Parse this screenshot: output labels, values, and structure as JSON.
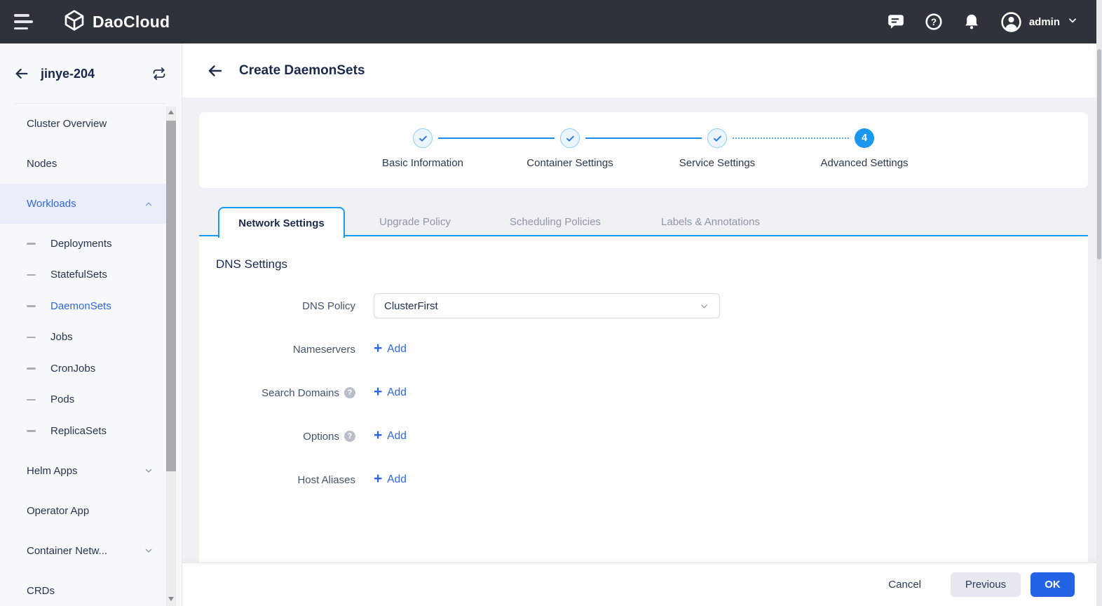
{
  "colors": {
    "topbar_bg": "#2e333b",
    "sidebar_bg": "#f7f8fa",
    "sidebar_active_bg": "#e9eef9",
    "main_bg": "#eff1f5",
    "accent": "#189af0",
    "link": "#3166e3",
    "ok_button": "#2563e6",
    "previous_button_bg": "#e7e9f0",
    "step_done_fill": "#eaf5fe",
    "step_done_border": "#8ecdf8",
    "muted_text": "#9097a5"
  },
  "topbar": {
    "brand": "DaoCloud",
    "user": "admin",
    "icons": [
      "menu-icon",
      "daocloud-logo-icon",
      "chat-icon",
      "help-icon",
      "bell-icon",
      "avatar-icon",
      "chevron-down-icon"
    ]
  },
  "sidebar": {
    "cluster": "jinye-204",
    "items": [
      {
        "label": "Cluster Overview"
      },
      {
        "label": "Nodes"
      },
      {
        "label": "Workloads",
        "active": true,
        "collapsible": true,
        "expanded": true
      },
      {
        "label": "Deployments",
        "sub": true
      },
      {
        "label": "StatefulSets",
        "sub": true
      },
      {
        "label": "DaemonSets",
        "sub": true,
        "active": true
      },
      {
        "label": "Jobs",
        "sub": true
      },
      {
        "label": "CronJobs",
        "sub": true
      },
      {
        "label": "Pods",
        "sub": true
      },
      {
        "label": "ReplicaSets",
        "sub": true
      },
      {
        "label": "Helm Apps",
        "collapsible": true,
        "expanded": false
      },
      {
        "label": "Operator App"
      },
      {
        "label": "Container Netw...",
        "collapsible": true,
        "expanded": false
      },
      {
        "label": "CRDs"
      }
    ]
  },
  "page": {
    "title": "Create DaemonSets",
    "steps": [
      {
        "label": "Basic Information",
        "state": "done"
      },
      {
        "label": "Container Settings",
        "state": "done"
      },
      {
        "label": "Service Settings",
        "state": "done"
      },
      {
        "label": "Advanced Settings",
        "state": "active",
        "number": "4"
      }
    ],
    "tabs": [
      {
        "label": "Network Settings",
        "active": true
      },
      {
        "label": "Upgrade Policy",
        "active": false
      },
      {
        "label": "Scheduling Policies",
        "active": false
      },
      {
        "label": "Labels & Annotations",
        "active": false
      }
    ],
    "section_title": "DNS Settings",
    "form": {
      "dns_policy": {
        "label": "DNS Policy",
        "value": "ClusterFirst"
      },
      "rows": [
        {
          "label": "Nameservers",
          "action": "Add",
          "help": false
        },
        {
          "label": "Search Domains",
          "action": "Add",
          "help": true
        },
        {
          "label": "Options",
          "action": "Add",
          "help": true
        },
        {
          "label": "Host Aliases",
          "action": "Add",
          "help": false
        }
      ]
    },
    "footer": {
      "cancel": "Cancel",
      "previous": "Previous",
      "ok": "OK"
    }
  }
}
